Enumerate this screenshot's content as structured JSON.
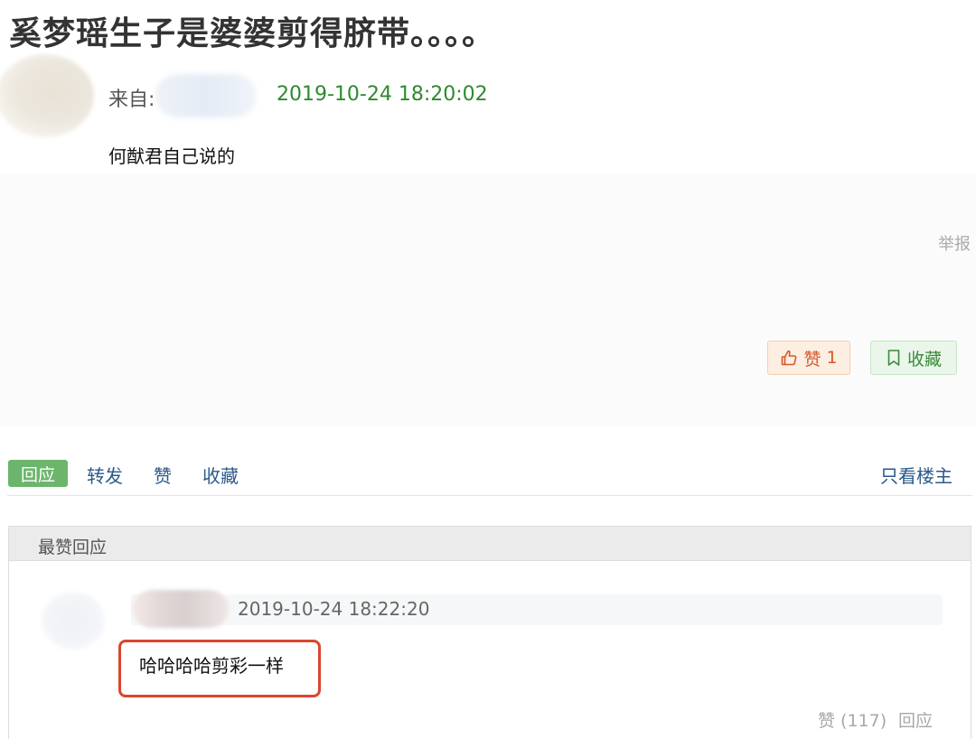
{
  "post": {
    "title": "奚梦瑶生子是婆婆剪得脐带。。。。",
    "from_label": "来自:",
    "timestamp": "2019-10-24 18:20:02",
    "body": "何猷君自己说的",
    "report_label": "举报",
    "like_label": "赞",
    "like_count": "1",
    "collect_label": "收藏"
  },
  "action_bar": {
    "reply_label": "回应",
    "forward_label": "转发",
    "like_label": "赞",
    "collect_label": "收藏",
    "op_only_label": "只看楼主"
  },
  "top_replies": {
    "title": "最赞回应",
    "items": [
      {
        "timestamp": "2019-10-24 18:22:20",
        "text": "哈哈哈哈剪彩一样",
        "like_label": "赞 (117)",
        "reply_label": "回应"
      }
    ]
  },
  "colors": {
    "timestamp_green": "#2e8a2e",
    "reply_button_green": "#6cb56c",
    "like_button_orange": "#d4592a",
    "link_blue": "#2a5a8a",
    "highlight_red": "#d9472b"
  },
  "icons": {
    "like": "thumbs-up-icon",
    "collect": "bookmark-icon"
  }
}
